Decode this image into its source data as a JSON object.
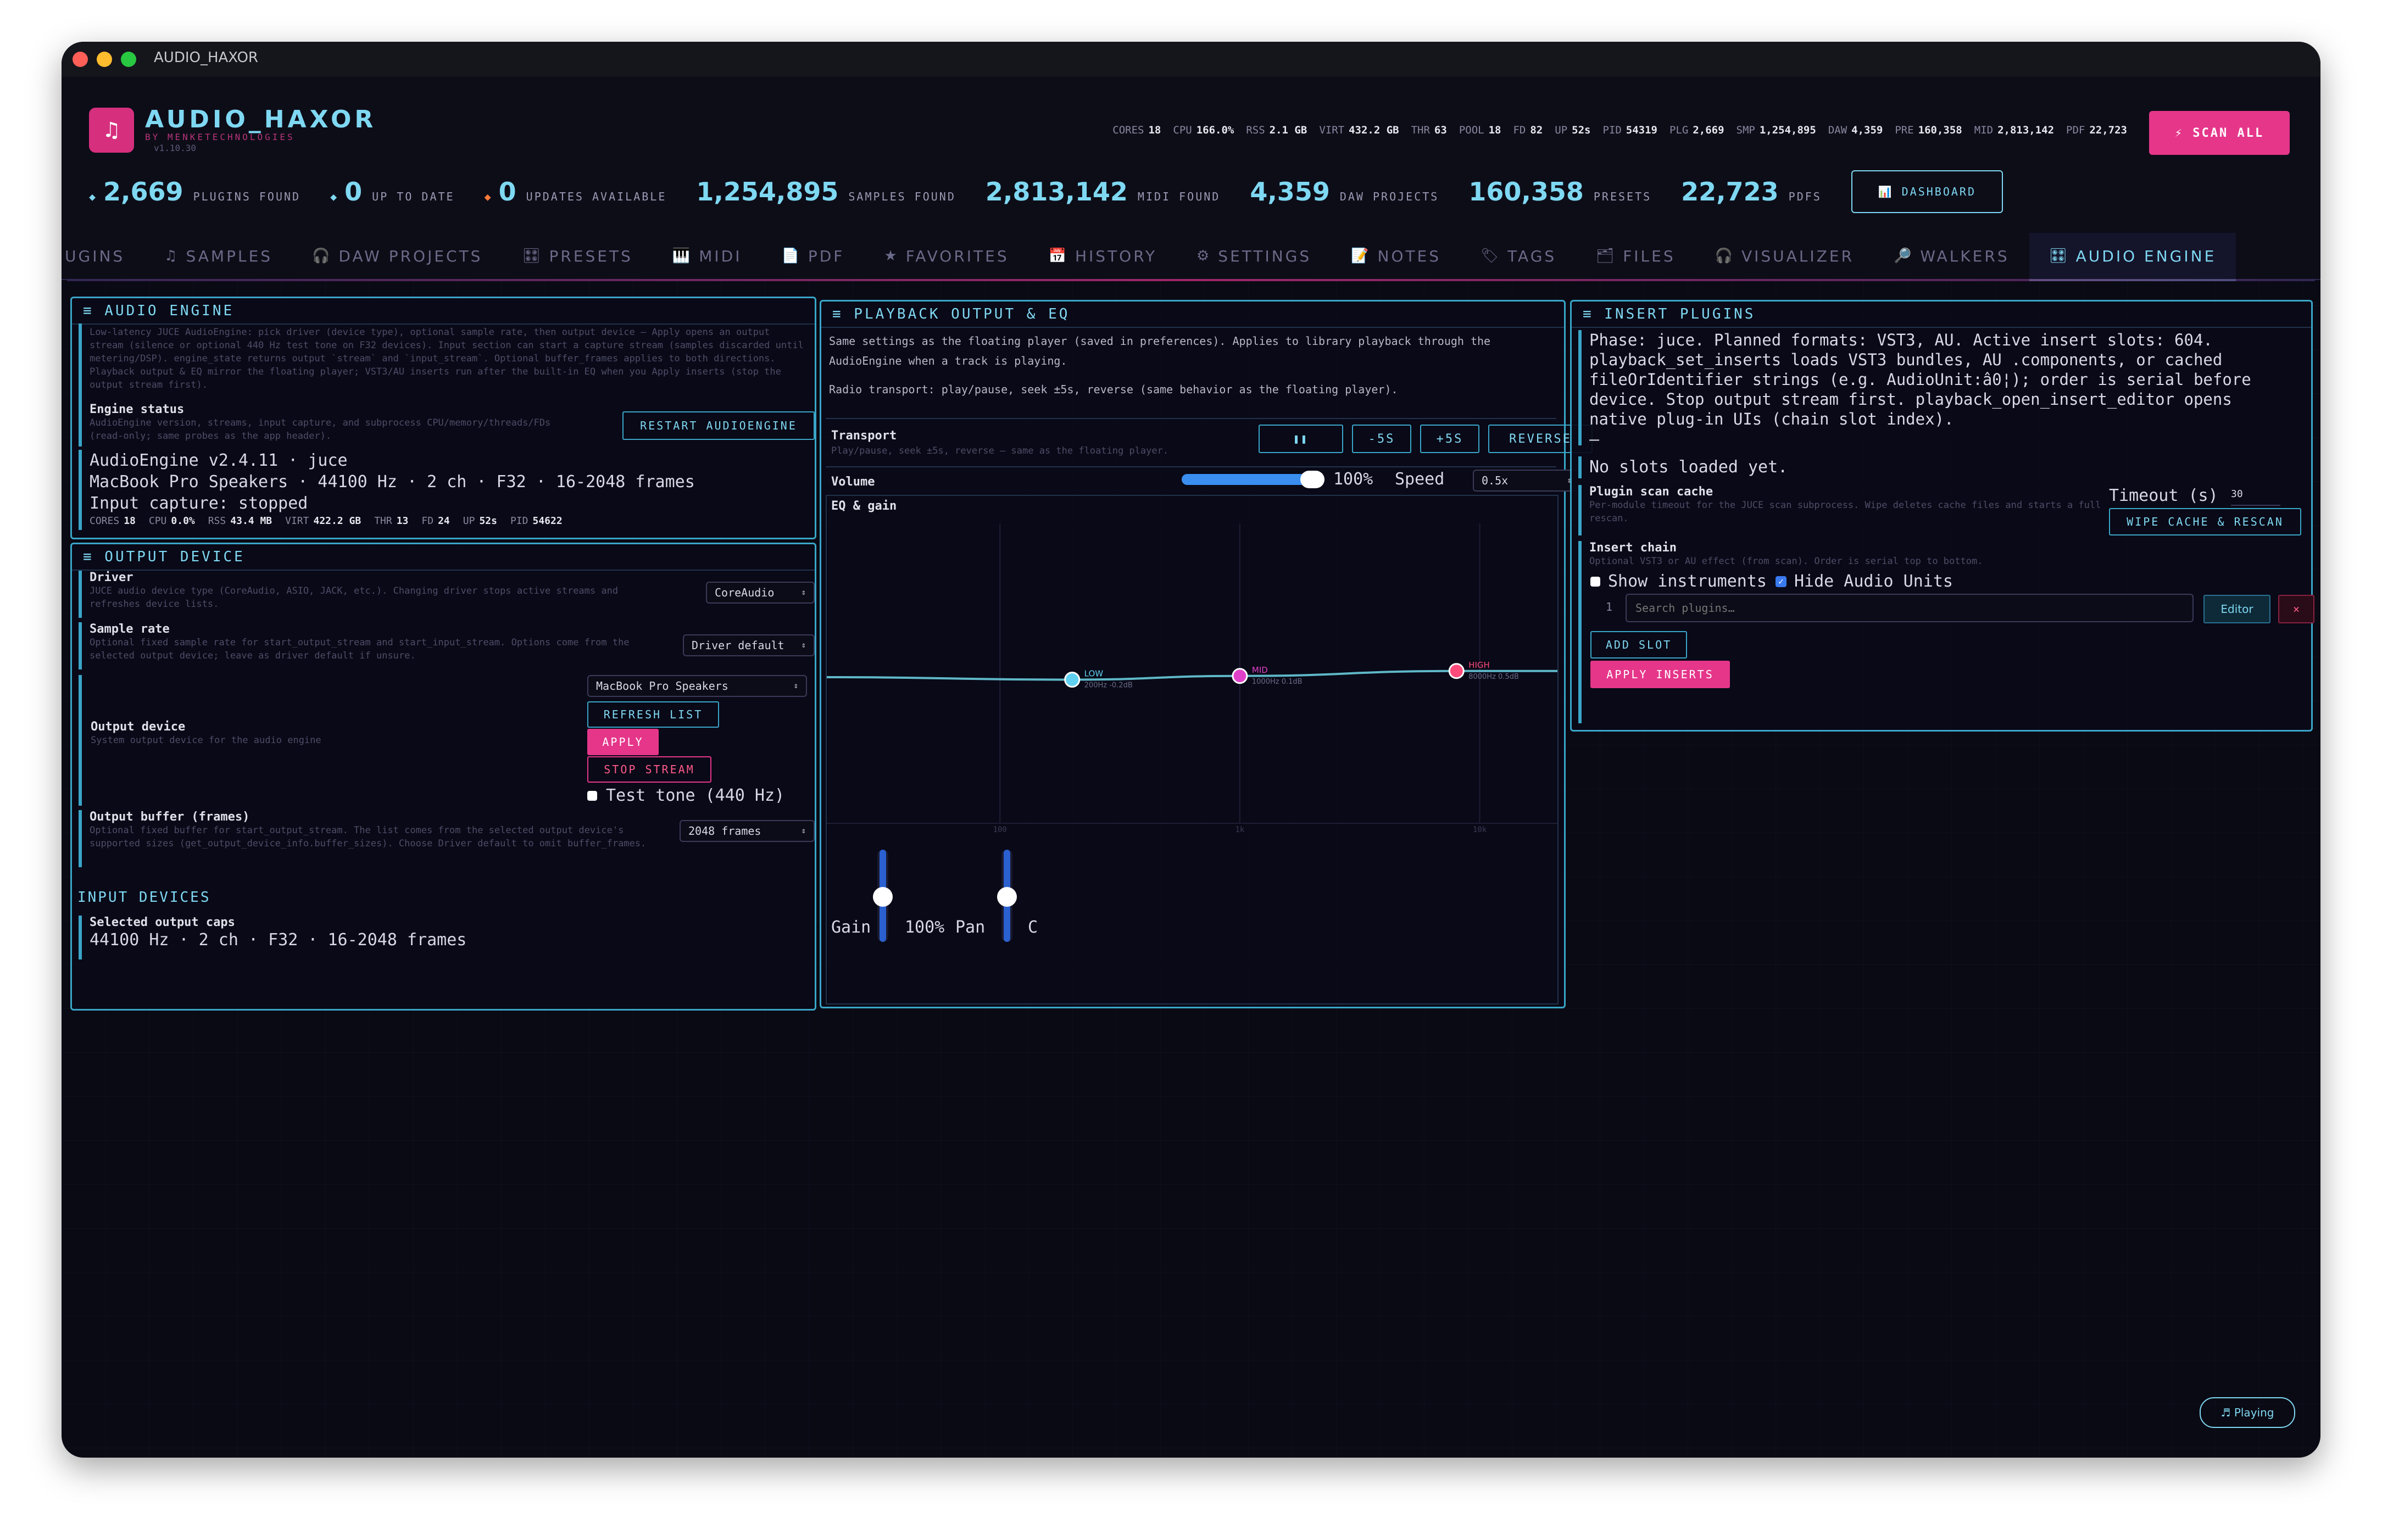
{
  "window": {
    "title": "AUDIO_HAXOR"
  },
  "header": {
    "app_name": "AUDIO_HAXOR",
    "subtitle": "BY MENKETECHNOLOGIES",
    "version": "v1.10.30",
    "logo_glyph": "♫",
    "metrics": [
      {
        "k": "CORES",
        "v": "18"
      },
      {
        "k": "CPU",
        "v": "166.0%"
      },
      {
        "k": "RSS",
        "v": "2.1 GB"
      },
      {
        "k": "VIRT",
        "v": "432.2 GB"
      },
      {
        "k": "THR",
        "v": "63"
      },
      {
        "k": "POOL",
        "v": "18"
      },
      {
        "k": "FD",
        "v": "82"
      },
      {
        "k": "UP",
        "v": "52s"
      },
      {
        "k": "PID",
        "v": "54319"
      },
      {
        "k": "PLG",
        "v": "2,669"
      },
      {
        "k": "SMP",
        "v": "1,254,895"
      },
      {
        "k": "DAW",
        "v": "4,359"
      },
      {
        "k": "PRE",
        "v": "160,358"
      },
      {
        "k": "MID",
        "v": "2,813,142"
      },
      {
        "k": "PDF",
        "v": "22,723"
      }
    ],
    "scan_all": "⚡ SCAN ALL",
    "stats": [
      {
        "num": "2,669",
        "label": "PLUGINS FOUND",
        "dot": "◆",
        "dot_color": "#7fd8f2"
      },
      {
        "num": "0",
        "label": "UP TO DATE",
        "dot": "◆",
        "dot_color": "#7fd8f2"
      },
      {
        "num": "0",
        "label": "UPDATES AVAILABLE",
        "dot": "◆",
        "dot_color": "#ff7a3a"
      },
      {
        "num": "1,254,895",
        "label": "SAMPLES FOUND",
        "dot": "",
        "dot_color": ""
      },
      {
        "num": "2,813,142",
        "label": "MIDI FOUND",
        "dot": "",
        "dot_color": ""
      },
      {
        "num": "4,359",
        "label": "DAW PROJECTS",
        "dot": "",
        "dot_color": ""
      },
      {
        "num": "160,358",
        "label": "PRESETS",
        "dot": "",
        "dot_color": ""
      },
      {
        "num": "22,723",
        "label": "PDFS",
        "dot": "",
        "dot_color": ""
      }
    ],
    "dashboard": "📊 DASHBOARD"
  },
  "tabs": [
    {
      "icon": "",
      "label": "UGINS"
    },
    {
      "icon": "♫",
      "label": "SAMPLES"
    },
    {
      "icon": "🎧",
      "label": "DAW PROJECTS"
    },
    {
      "icon": "🎛",
      "label": "PRESETS"
    },
    {
      "icon": "🎹",
      "label": "MIDI"
    },
    {
      "icon": "📄",
      "label": "PDF"
    },
    {
      "icon": "★",
      "label": "FAVORITES"
    },
    {
      "icon": "📅",
      "label": "HISTORY"
    },
    {
      "icon": "⚙",
      "label": "SETTINGS"
    },
    {
      "icon": "📝",
      "label": "NOTES"
    },
    {
      "icon": "🏷",
      "label": "TAGS"
    },
    {
      "icon": "🗂",
      "label": "FILES"
    },
    {
      "icon": "🎧",
      "label": "VISUALIZER"
    },
    {
      "icon": "🔎",
      "label": "WALKERS"
    },
    {
      "icon": "🎛",
      "label": "AUDIO ENGINE"
    }
  ],
  "audio_engine": {
    "title": "≡ AUDIO ENGINE",
    "desc": "Low-latency JUCE AudioEngine: pick driver (device type), optional sample rate, then output device — Apply opens an output stream (silence or optional 440 Hz test tone on F32 devices). Input section can start a capture stream (samples discarded until metering/DSP). engine_state returns output `stream` and `input_stream`. Optional buffer_frames applies to both directions. Playback output & EQ mirror the floating player; VST3/AU inserts run after the built-in EQ when you Apply inserts (stop the output stream first).",
    "status_label": "Engine status",
    "status_desc": "AudioEngine version, streams, input capture, and subprocess CPU/memory/threads/FDs (read-only; same probes as the app header).",
    "restart": "RESTART AUDIOENGINE",
    "line1": "AudioEngine v2.4.11 · juce",
    "line2": "MacBook Pro Speakers · 44100 Hz · 2 ch · F32 · 16-2048 frames",
    "line3": "Input capture: stopped",
    "proc": [
      {
        "k": "CORES",
        "v": "18"
      },
      {
        "k": "CPU",
        "v": "0.0%"
      },
      {
        "k": "RSS",
        "v": "43.4 MB"
      },
      {
        "k": "VIRT",
        "v": "422.2 GB"
      },
      {
        "k": "THR",
        "v": "13"
      },
      {
        "k": "FD",
        "v": "24"
      },
      {
        "k": "UP",
        "v": "52s"
      },
      {
        "k": "PID",
        "v": "54622"
      }
    ]
  },
  "output_device": {
    "title": "≡ OUTPUT DEVICE",
    "driver_label": "Driver",
    "driver_desc": "JUCE audio device type (CoreAudio, ASIO, JACK, etc.). Changing driver stops active streams and refreshes device lists.",
    "driver_value": "CoreAudio",
    "rate_label": "Sample rate",
    "rate_desc": "Optional fixed sample rate for start_output_stream and start_input_stream. Options come from the selected output device; leave as driver default if unsure.",
    "rate_value": "Driver default",
    "device_value": "MacBook Pro Speakers",
    "refresh": "REFRESH LIST",
    "apply": "APPLY",
    "stop": "STOP STREAM",
    "device_label": "Output device",
    "device_desc": "System output device for the audio engine",
    "test_tone": "Test tone (440 Hz)",
    "buffer_label": "Output buffer (frames)",
    "buffer_desc": "Optional fixed buffer for start_output_stream. The list comes from the selected output device's supported sizes (get_output_device_info.buffer_sizes). Choose Driver default to omit buffer_frames.",
    "buffer_value": "2048 frames",
    "input_title": "INPUT DEVICES",
    "caps_label": "Selected output caps",
    "caps_value": "44100 Hz · 2 ch · F32 · 16-2048 frames"
  },
  "playback": {
    "title": "≡ PLAYBACK OUTPUT & EQ",
    "desc1": "Same settings as the floating player (saved in preferences). Applies to library playback through the AudioEngine when a track is playing.",
    "desc2": "Radio transport: play/pause, seek ±5s, reverse (same behavior as the floating player).",
    "transport_label": "Transport",
    "transport_desc": "Play/pause, seek ±5s, reverse — same as the floating player.",
    "pause": "❚❚",
    "back5": "-5S",
    "fwd5": "+5S",
    "reverse": "REVERSE",
    "volume_label": "Volume",
    "volume_fraction": 1.0,
    "volume_value": "100%",
    "speed_label": "Speed",
    "speed_value": "0.5x",
    "eq_label": "EQ & gain",
    "eq_bands": [
      {
        "name": "LOW",
        "info": "200Hz -0.2dB",
        "freq": 200,
        "gain": -0.2,
        "color": "#5fd0f0"
      },
      {
        "name": "MID",
        "info": "1000Hz 0.1dB",
        "freq": 1000,
        "gain": 0.1,
        "color": "#e040c8"
      },
      {
        "name": "HIGH",
        "info": "8000Hz 0.5dB",
        "freq": 8000,
        "gain": 0.5,
        "color": "#ff4a7a"
      }
    ],
    "eq_ticks": [
      "100",
      "1k",
      "10k"
    ],
    "gain_label": "Gain",
    "gain_value": "100%",
    "pan_label": "Pan",
    "pan_value": "C"
  },
  "inserts": {
    "title": "≡ INSERT PLUGINS",
    "desc": "Phase: juce. Planned formats: VST3, AU. Active insert slots: 604. playback_set_inserts loads VST3 bundles, AU .components, or cached fileOrIdentifier strings (e.g. AudioUnit:â0¦); order is serial before device. Stop output stream first. playback_open_insert_editor opens native plug-in UIs (chain slot index).",
    "dash": "—",
    "no_slots": "No slots loaded yet.",
    "cache_label": "Plugin scan cache",
    "cache_desc": "Per-module timeout for the JUCE scan subprocess. Wipe deletes cache files and starts a full rescan.",
    "timeout_label": "Timeout (s)",
    "timeout_value": "30",
    "wipe": "WIPE CACHE & RESCAN",
    "chain_label": "Insert chain",
    "chain_desc": "Optional VST3 or AU effect (from scan). Order is serial top to bottom.",
    "show_instruments": "Show instruments",
    "hide_au": "Hide Audio Units",
    "slot_num": "1",
    "search_placeholder": "Search plugins…",
    "editor": "Editor",
    "remove": "×",
    "add_slot": "ADD SLOT",
    "apply_inserts": "APPLY INSERTS"
  },
  "footer": {
    "playing": "♬ Playing"
  },
  "colors": {
    "accent": "#7fd8f2",
    "pink": "#e5368a",
    "bg": "#0a0a14"
  }
}
